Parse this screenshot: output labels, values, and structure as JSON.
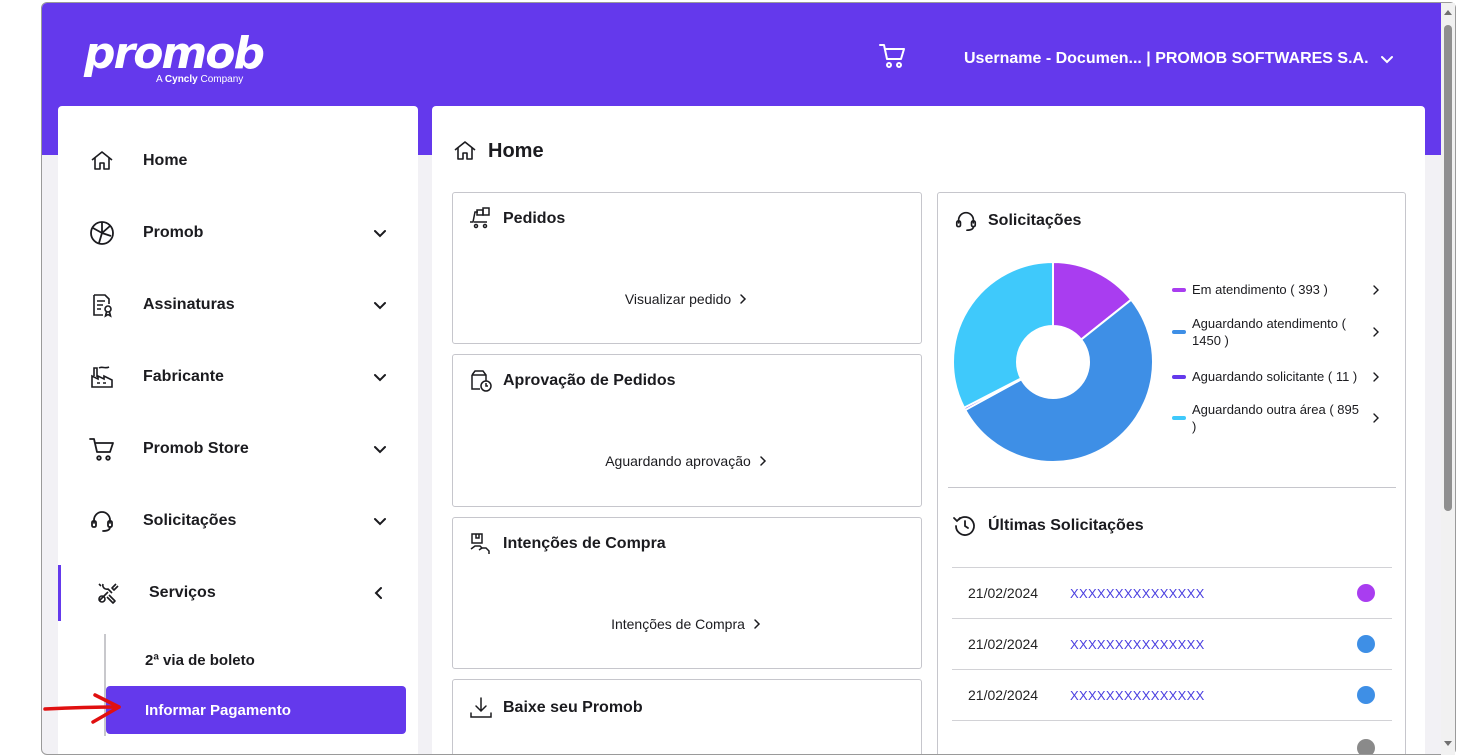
{
  "header": {
    "logo_text": "promob",
    "logo_sub_prefix": "A ",
    "logo_sub_brand": "Cyncly",
    "logo_sub_suffix": " Company",
    "user_label": "Username - Documen... | PROMOB SOFTWARES S.A."
  },
  "sidebar": {
    "items": [
      {
        "label": "Home",
        "icon": "home-icon"
      },
      {
        "label": "Promob",
        "icon": "promob-logo-icon"
      },
      {
        "label": "Assinaturas",
        "icon": "subscription-certificate-icon"
      },
      {
        "label": "Fabricante",
        "icon": "factory-icon"
      },
      {
        "label": "Promob Store",
        "icon": "cart-icon"
      },
      {
        "label": "Solicitações",
        "icon": "headset-icon"
      },
      {
        "label": "Serviços",
        "icon": "tools-icon"
      }
    ],
    "sub_items": [
      {
        "label": "2ª via de boleto"
      },
      {
        "label": "Informar Pagamento"
      }
    ]
  },
  "main": {
    "title": "Home",
    "cards": [
      {
        "title": "Pedidos",
        "link": "Visualizar pedido",
        "icon": "package-cart-icon"
      },
      {
        "title": "Aprovação de Pedidos",
        "link": "Aguardando aprovação",
        "icon": "box-clock-icon"
      },
      {
        "title": "Intenções de Compra",
        "link": "Intenções de Compra",
        "icon": "box-hand-icon"
      },
      {
        "title": "Baixe seu Promob",
        "icon": "download-icon"
      }
    ]
  },
  "solicitacoes": {
    "title": "Solicitações",
    "legend": [
      {
        "label": "Em atendimento ( 393 )",
        "color": "#a93df0"
      },
      {
        "label": "Aguardando atendimento ( 1450 )",
        "color": "#3e8fe6"
      },
      {
        "label": "Aguardando solicitante ( 11 )",
        "color": "#6439ec"
      },
      {
        "label": "Aguardando outra área ( 895 )",
        "color": "#3fc9fb"
      }
    ],
    "ultimas_title": "Últimas Solicitações",
    "rows": [
      {
        "date": "21/02/2024",
        "id": "XXXXXXXXXXXXXXX",
        "color": "#a93df0"
      },
      {
        "date": "21/02/2024",
        "id": "XXXXXXXXXXXXXXX",
        "color": "#3e8fe6"
      },
      {
        "date": "21/02/2024",
        "id": "XXXXXXXXXXXXXXX",
        "color": "#3e8fe6"
      }
    ]
  }
}
